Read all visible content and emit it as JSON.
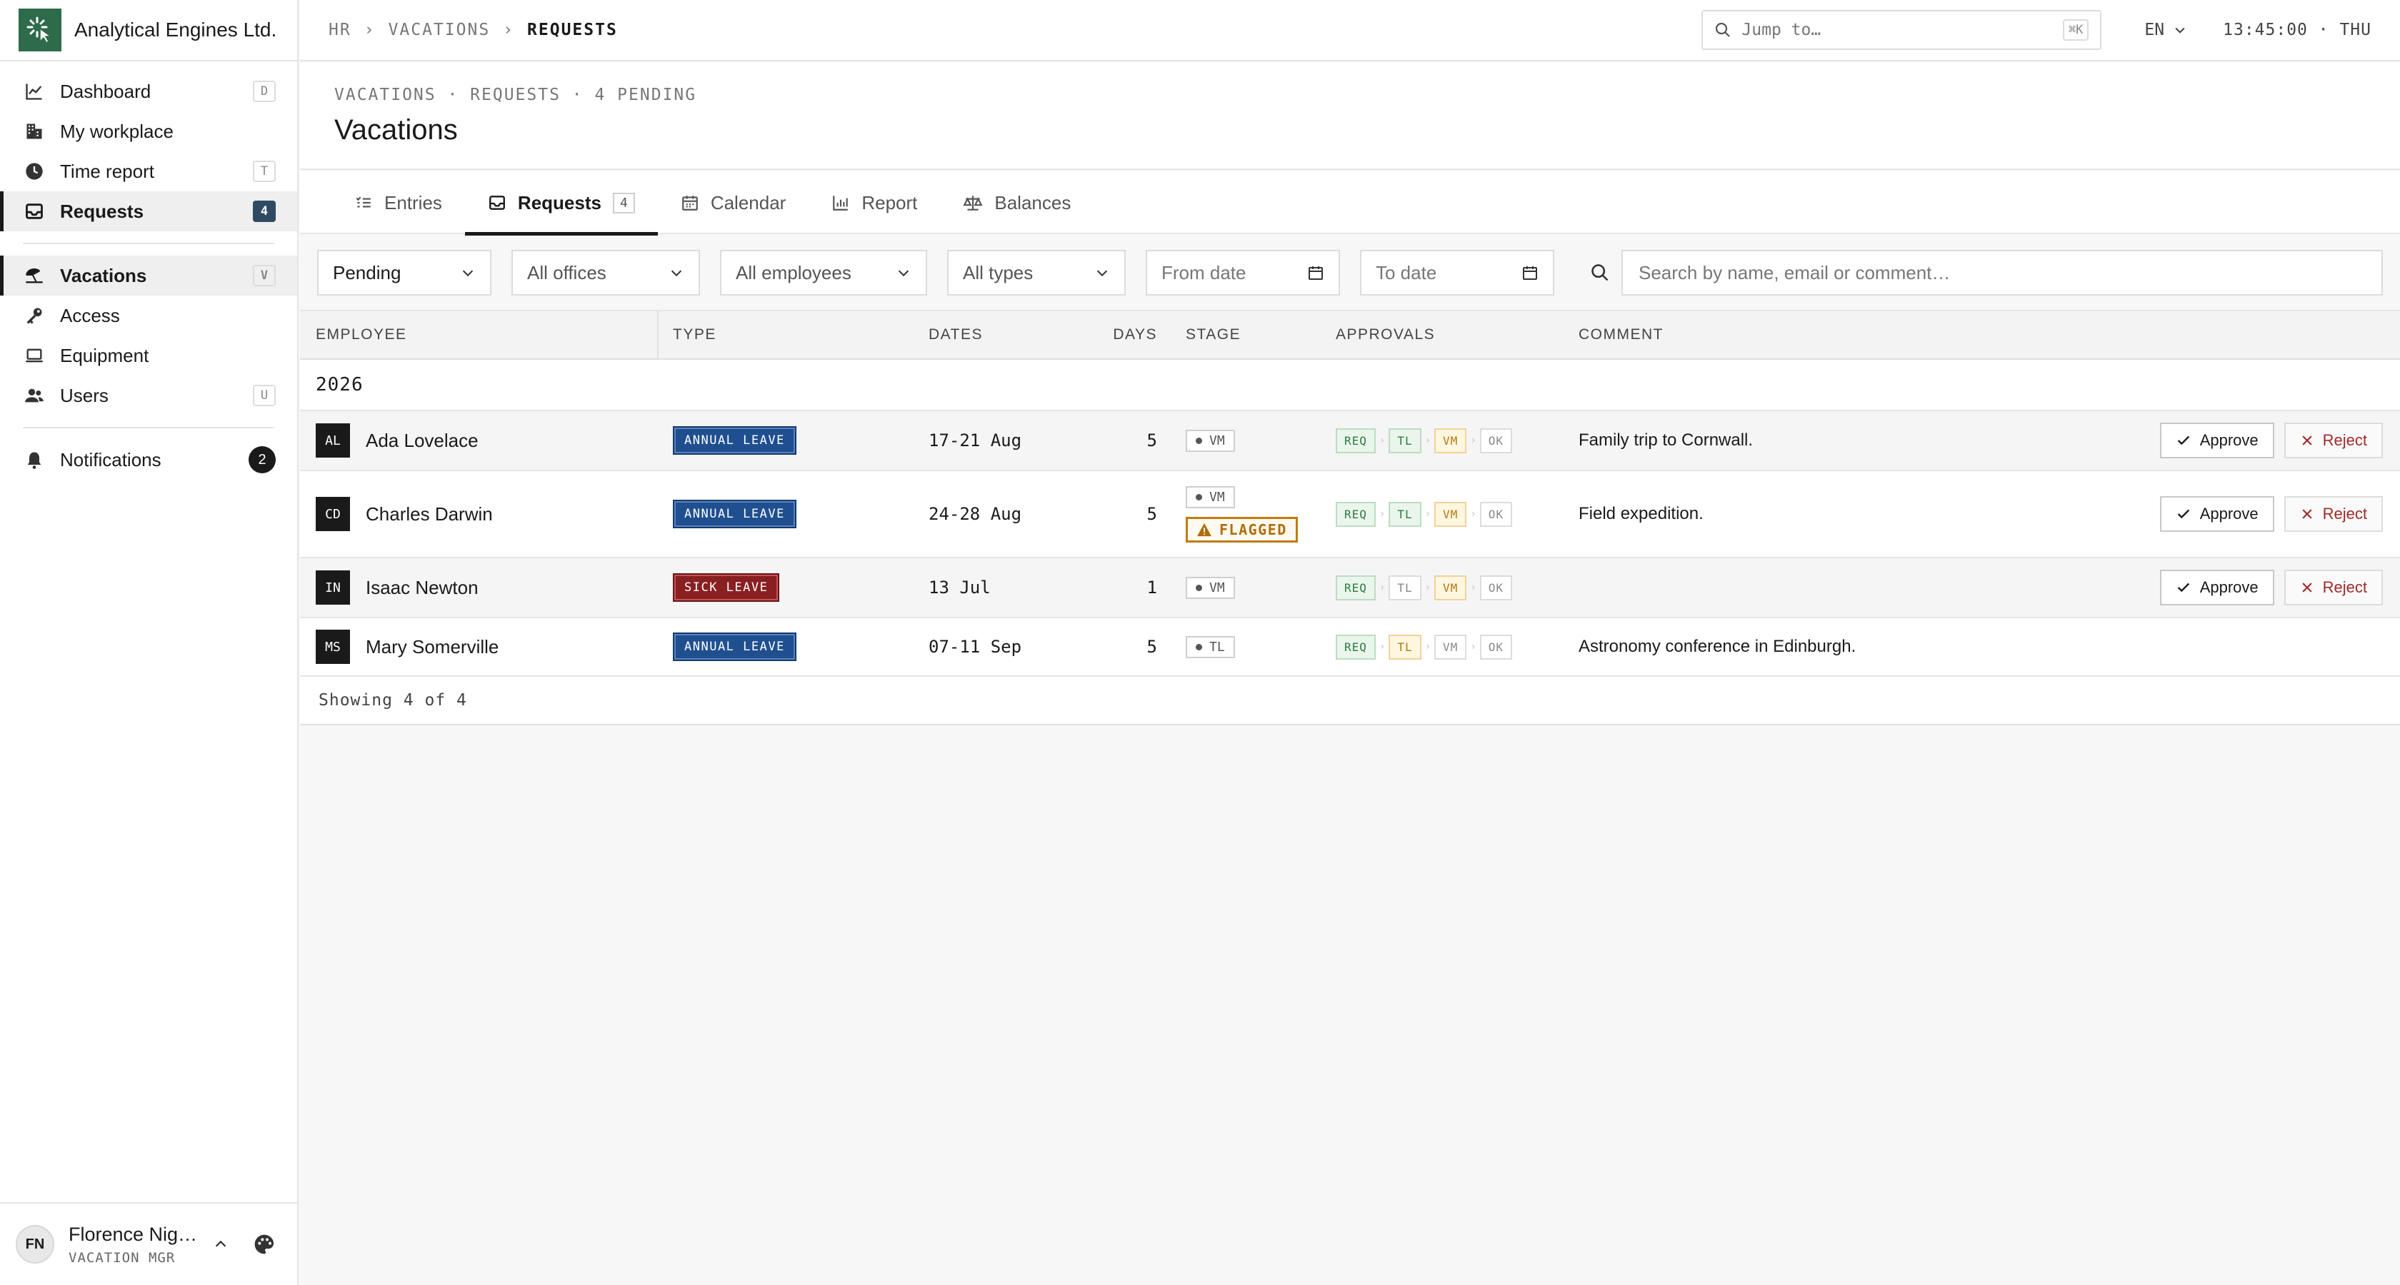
{
  "brand": {
    "name": "Analytical Engines Ltd."
  },
  "sidebar": {
    "items": [
      {
        "label": "Dashboard",
        "icon": "chart-line-icon",
        "shortcut": "D"
      },
      {
        "label": "My workplace",
        "icon": "building-icon",
        "shortcut": ""
      },
      {
        "label": "Time report",
        "icon": "clock-icon",
        "shortcut": "T"
      },
      {
        "label": "Requests",
        "icon": "inbox-icon",
        "count": "4"
      },
      {
        "label": "Vacations",
        "icon": "umbrella-icon",
        "shortcut": "V"
      },
      {
        "label": "Access",
        "icon": "key-icon",
        "shortcut": ""
      },
      {
        "label": "Equipment",
        "icon": "laptop-icon",
        "shortcut": ""
      },
      {
        "label": "Users",
        "icon": "users-icon",
        "shortcut": "U"
      },
      {
        "label": "Notifications",
        "icon": "bell-icon",
        "count": "2"
      }
    ],
    "user": {
      "initials": "FN",
      "name": "Florence Nig…",
      "role": "VACATION MGR"
    }
  },
  "topbar": {
    "breadcrumb": [
      "HR",
      "VACATIONS",
      "REQUESTS"
    ],
    "breadcrumb_sep": "›",
    "jump_placeholder": "Jump to…",
    "jump_shortcut": "⌘K",
    "language": "EN",
    "clock": "13:45:00 · THU"
  },
  "header": {
    "subtitle": "VACATIONS · REQUESTS · 4 PENDING",
    "title": "Vacations"
  },
  "tabs": [
    {
      "label": "Entries",
      "icon": "list-icon"
    },
    {
      "label": "Requests",
      "icon": "inbox-icon",
      "count": "4",
      "active": true
    },
    {
      "label": "Calendar",
      "icon": "calendar-icon"
    },
    {
      "label": "Report",
      "icon": "bar-chart-icon"
    },
    {
      "label": "Balances",
      "icon": "scale-icon"
    }
  ],
  "filters": {
    "status": "Pending",
    "office": "All offices",
    "employee": "All employees",
    "type": "All types",
    "from_placeholder": "From date",
    "to_placeholder": "To date",
    "search_placeholder": "Search by name, email or comment…"
  },
  "table": {
    "columns": [
      "EMPLOYEE",
      "TYPE",
      "DATES",
      "DAYS",
      "STAGE",
      "APPROVALS",
      "COMMENT"
    ],
    "group": "2026",
    "approve_label": "Approve",
    "reject_label": "Reject",
    "rows": [
      {
        "initials": "AL",
        "name": "Ada Lovelace",
        "type": "ANNUAL LEAVE",
        "dates": "17-21 Aug",
        "days": "5",
        "stage": "VM",
        "flag": "",
        "steps": [
          "REQ",
          "TL",
          "VM",
          "OK"
        ],
        "comment": "Family trip to Cornwall."
      },
      {
        "initials": "CD",
        "name": "Charles Darwin",
        "type": "ANNUAL LEAVE",
        "dates": "24-28 Aug",
        "days": "5",
        "stage": "VM",
        "flag": "FLAGGED",
        "steps": [
          "REQ",
          "TL",
          "VM",
          "OK"
        ],
        "comment": "Field expedition."
      },
      {
        "initials": "IN",
        "name": "Isaac Newton",
        "type": "SICK LEAVE",
        "dates": "13 Jul",
        "days": "1",
        "stage": "VM",
        "flag": "",
        "steps": [
          "REQ",
          "TL",
          "VM",
          "OK"
        ],
        "comment": ""
      },
      {
        "initials": "MS",
        "name": "Mary Somerville",
        "type": "ANNUAL LEAVE",
        "dates": "07-11 Sep",
        "days": "5",
        "stage": "TL",
        "flag": "",
        "steps": [
          "REQ",
          "TL",
          "VM",
          "OK"
        ],
        "comment": "Astronomy conference in Edinburgh."
      }
    ],
    "footer": "Showing 4 of 4"
  },
  "colors": {
    "brand": "#2e6b4a",
    "annual": "#1f4f8f",
    "sick": "#8a1f22",
    "flag": "#c27a10",
    "reject": "#a12a2a"
  }
}
